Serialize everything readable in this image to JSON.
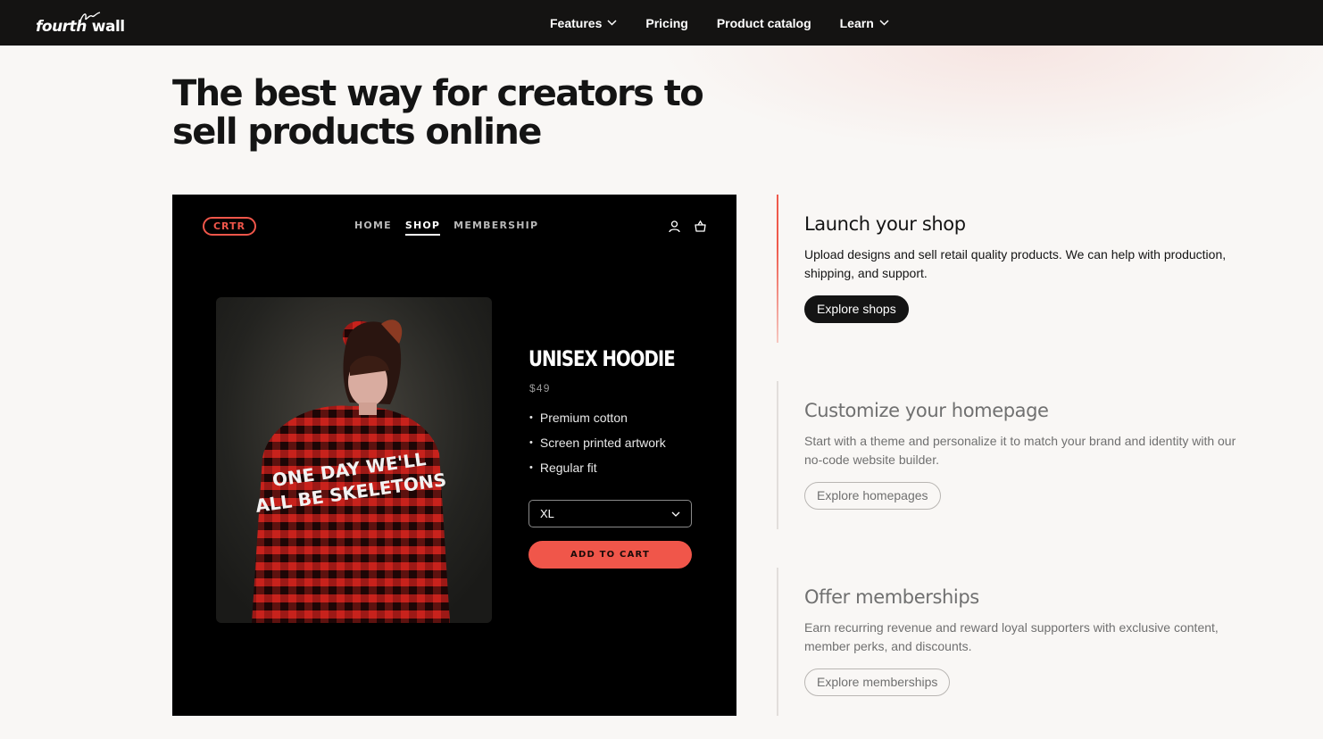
{
  "brand": {
    "logo_part1": "fourth",
    "logo_part2": "wall"
  },
  "nav": {
    "features": "Features",
    "pricing": "Pricing",
    "catalog": "Product catalog",
    "learn": "Learn"
  },
  "hero": {
    "headline_line1": "The best way for creators to",
    "headline_line2": "sell products online"
  },
  "preview": {
    "logo": "CRTR",
    "nav": [
      "HOME",
      "SHOP",
      "MEMBERSHIP"
    ],
    "active_nav": "SHOP",
    "icons": [
      "user-icon",
      "shopping-basket-icon"
    ],
    "product": {
      "title": "UNISEX HOODIE",
      "price": "$49",
      "features": [
        "Premium cotton",
        "Screen printed artwork",
        "Regular fit"
      ],
      "size": "XL",
      "add_to_cart": "ADD TO CART",
      "hoodie_print": "ONE DAY WE'LL ALL BE SKELETONS"
    },
    "colors": {
      "accent": "#f0564a",
      "background": "#000000"
    }
  },
  "blocks": [
    {
      "title": "Launch your shop",
      "text": "Upload designs and sell retail quality products. We can help with production, shipping, and support.",
      "button": "Explore shops",
      "active": true
    },
    {
      "title": "Customize your homepage",
      "text": "Start with a theme and personalize it to match your brand and identity with our no-code website builder.",
      "button": "Explore homepages",
      "active": false
    },
    {
      "title": "Offer memberships",
      "text": "Earn recurring revenue and reward loyal supporters with exclusive content, member perks, and discounts.",
      "button": "Explore memberships",
      "active": false
    }
  ]
}
